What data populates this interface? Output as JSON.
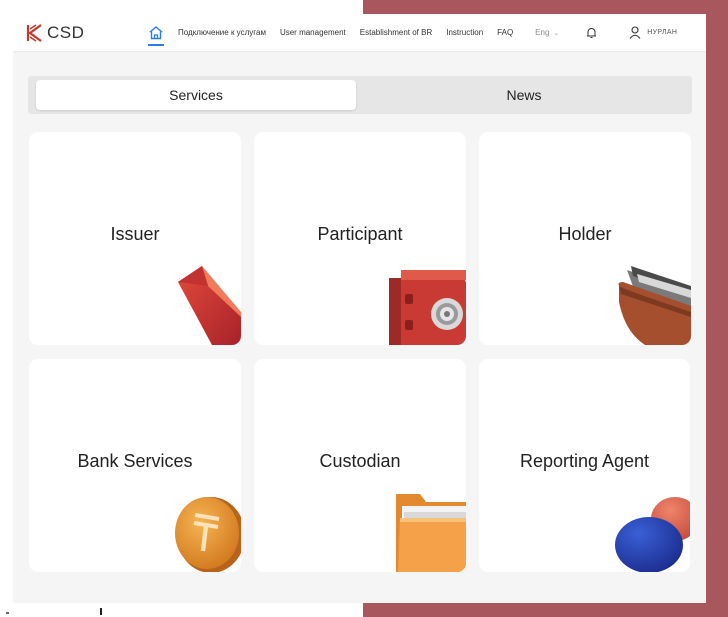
{
  "header": {
    "logo_text": "CSD",
    "nav": [
      {
        "label": "Подключение к услугам"
      },
      {
        "label": "User management"
      },
      {
        "label": "Establishment of BR"
      },
      {
        "label": "Instruction"
      },
      {
        "label": "FAQ"
      }
    ],
    "language": "Eng",
    "user_name": "НУРЛАН"
  },
  "tabs": {
    "services": "Services",
    "news": "News"
  },
  "cards": [
    {
      "title": "Issuer",
      "icon": "envelope-icon"
    },
    {
      "title": "Participant",
      "icon": "safe-icon"
    },
    {
      "title": "Holder",
      "icon": "wallet-icon"
    },
    {
      "title": "Bank Services",
      "icon": "tenge-coin-icon"
    },
    {
      "title": "Custodian",
      "icon": "folder-icon"
    },
    {
      "title": "Reporting Agent",
      "icon": "blob-icon"
    }
  ],
  "colors": {
    "accent": "#2d7be8",
    "brand_red": "#c0392b",
    "frame": "#a8585c"
  }
}
